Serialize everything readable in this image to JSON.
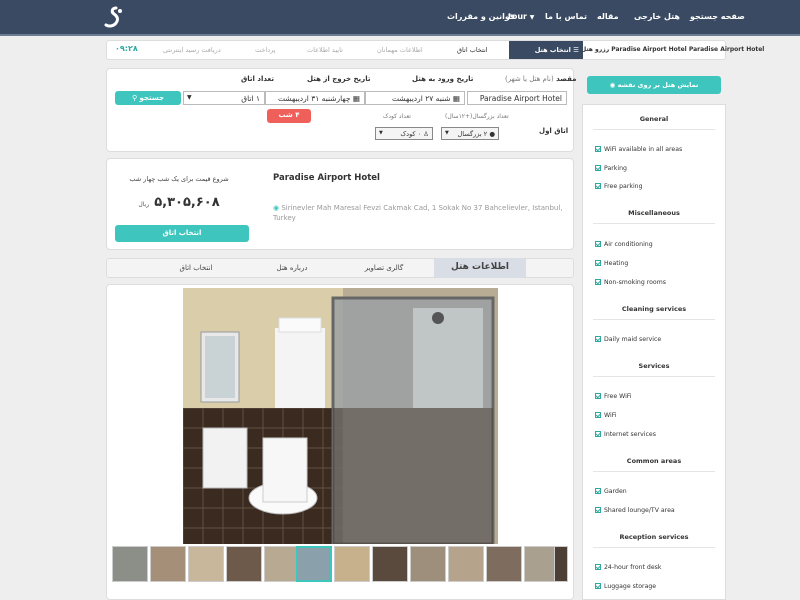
{
  "nav": {
    "items": [
      "صفحه جستجو",
      "هتل خارجی",
      "مقاله",
      "تماس با ما",
      "tour",
      "قوانین و مقررات"
    ],
    "bg_color": "#3a4a63"
  },
  "breadcrumb": {
    "hotel_crumb": "Paradise Airport Hotel Paradise Airport Hotel رزرو هتل",
    "active_step": "انتخاب هتل",
    "steps": [
      "انتخاب اتاق",
      "اطلاعات مهمانان",
      "تایید اطلاعات",
      "پرداخت",
      "دریافت رسید اینترنتی"
    ],
    "timer": "۰۹:۲۸"
  },
  "search": {
    "destination_label": "مقصد",
    "destination_hint": "(نام هتل یا شهر)",
    "destination_value": "Paradise Airport Hotel",
    "checkin_label": "تاریخ ورود به هتل",
    "checkin_value": "شنبه ۲۷ اردیبهشت",
    "checkout_label": "تاریخ خروج از هتل",
    "checkout_value": "چهارشنبه ۳۱ اردیبهشت",
    "rooms_label": "تعداد اتاق",
    "rooms_value": "۱ اتاق",
    "search_button": "جستجو",
    "nights_badge": "۴ شب",
    "room_title": "اتاق اول",
    "adults_label": "تعداد بزرگسال(+۱۲سال)",
    "adults_value": "۲ بزرگسال",
    "children_label": "تعداد کودک",
    "children_value": "۰ کودک"
  },
  "map_button": "نمایش هتل بر روی نقشه",
  "hotel": {
    "name": "Paradise Airport Hotel",
    "address": "Sirinevler Mah Maresal Fevzi Cakmak Cad, 1 Sokak No 37 Bahcelievler, Istanbul, Turkey",
    "price_caption": "شروع قیمت برای یک شب چهار شب",
    "price": "۵,۳۰۵,۶۰۸",
    "currency": "ریال",
    "select_button": "انتخاب اتاق"
  },
  "tabs": [
    "اطلاعات هتل",
    "گالری تصاویر",
    "درباره هتل",
    "انتخاب اتاق"
  ],
  "facilities": [
    {
      "title": "General",
      "items": [
        "WiFi available in all areas",
        "Parking",
        "Free parking"
      ]
    },
    {
      "title": "Miscellaneous",
      "items": [
        "Air conditioning",
        "Heating",
        "Non-smoking rooms"
      ]
    },
    {
      "title": "Cleaning services",
      "items": [
        "Daily maid service"
      ]
    },
    {
      "title": "Services",
      "items": [
        "Free WiFi",
        "WiFi",
        "Internet services"
      ]
    },
    {
      "title": "Common areas",
      "items": [
        "Garden",
        "Shared lounge/TV area"
      ]
    },
    {
      "title": "Reception services",
      "items": [
        "24-hour front desk",
        "Luggage storage"
      ]
    }
  ],
  "colors": {
    "accent": "#3ec6be",
    "badge": "#f0605a",
    "navy": "#3a4a63"
  },
  "icons": [
    "logo-icon",
    "list-icon",
    "calendar-icon",
    "search-icon",
    "map-pin-icon",
    "user-icon",
    "child-icon",
    "check-icon"
  ]
}
